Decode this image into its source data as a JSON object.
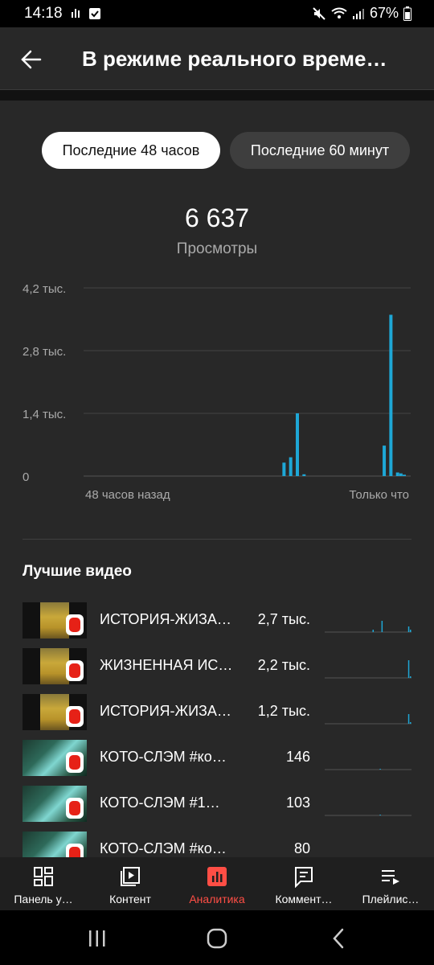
{
  "status": {
    "time": "14:18",
    "battery": "67%"
  },
  "header": {
    "title": "В режиме реального време…"
  },
  "chips": {
    "active_label": "Последние 48 часов",
    "inactive_label": "Последние 60 минут"
  },
  "metric": {
    "value": "6 637",
    "label": "Просмотры"
  },
  "chart_data": {
    "type": "bar",
    "ylabels": [
      "4,2 тыс.",
      "2,8 тыс.",
      "1,4 тыс.",
      "0"
    ],
    "yticks": [
      4200,
      2800,
      1400,
      0
    ],
    "ylim": [
      0,
      4200
    ],
    "x_start_label": "48 часов назад",
    "x_end_label": "Только что",
    "x_hours_ago": [
      18,
      17,
      16,
      15,
      3,
      2,
      1,
      0.5,
      0
    ],
    "values": [
      300,
      420,
      1400,
      40,
      680,
      3600,
      80,
      60,
      30
    ],
    "grid": true,
    "bar_color": "#1ea7d6"
  },
  "top_videos": {
    "title": "Лучшие видео",
    "items": [
      {
        "title": "ИСТОРИЯ-ЖИЗА…",
        "views": "2,7 тыс.",
        "thumb": "yellow",
        "spark": [
          0,
          0,
          0,
          0,
          0,
          0,
          0,
          0,
          0,
          0,
          0,
          0,
          0,
          0,
          0,
          0,
          0,
          0,
          0,
          0,
          0,
          0,
          0,
          0,
          0,
          0,
          3,
          0,
          0,
          0,
          0,
          14,
          0,
          0,
          0,
          0,
          0,
          0,
          0,
          0,
          0,
          0,
          0,
          0,
          0,
          0,
          7,
          3
        ]
      },
      {
        "title": "ЖИЗНЕННАЯ ИС…",
        "views": "2,2 тыс.",
        "thumb": "yellow",
        "spark": [
          0,
          0,
          0,
          0,
          0,
          0,
          0,
          0,
          0,
          0,
          0,
          0,
          0,
          0,
          0,
          0,
          0,
          0,
          0,
          0,
          0,
          0,
          0,
          0,
          0,
          0,
          0,
          0,
          0,
          0,
          0,
          0,
          0,
          0,
          0,
          0,
          0,
          0,
          0,
          0,
          0,
          0,
          0,
          0,
          0,
          0,
          22,
          2
        ]
      },
      {
        "title": "ИСТОРИЯ-ЖИЗА…",
        "views": "1,2 тыс.",
        "thumb": "yellow",
        "spark": [
          0,
          0,
          0,
          0,
          0,
          0,
          0,
          0,
          0,
          0,
          0,
          0,
          0,
          0,
          0,
          0,
          0,
          0,
          0,
          0,
          0,
          0,
          0,
          0,
          0,
          0,
          0,
          0,
          0,
          0,
          0,
          0,
          0,
          0,
          0,
          0,
          0,
          0,
          0,
          0,
          0,
          0,
          0,
          0,
          0,
          0,
          12,
          2
        ]
      },
      {
        "title": "КОТО-СЛЭМ #ко…",
        "views": "146",
        "thumb": "teal",
        "spark": [
          0,
          0,
          0,
          0,
          0,
          0,
          0,
          0,
          0,
          0,
          0,
          0,
          0,
          0,
          0,
          0,
          0,
          0,
          0,
          0,
          0,
          0,
          0,
          0,
          0,
          0,
          0,
          0,
          0,
          0,
          1,
          0,
          0,
          0,
          0,
          0,
          0,
          0,
          0,
          0,
          0,
          0,
          0,
          0,
          0,
          0,
          0,
          0
        ]
      },
      {
        "title": "КОТО-СЛЭМ #1…",
        "views": "103",
        "thumb": "teal",
        "spark": [
          0,
          0,
          0,
          0,
          0,
          0,
          0,
          0,
          0,
          0,
          0,
          0,
          0,
          0,
          0,
          0,
          0,
          0,
          0,
          0,
          0,
          0,
          0,
          0,
          0,
          0,
          0,
          0,
          0,
          0,
          1,
          0,
          0,
          0,
          0,
          0,
          0,
          0,
          0,
          0,
          0,
          0,
          0,
          0,
          0,
          0,
          0,
          0
        ]
      },
      {
        "title": "КОТО-СЛЭМ #ко…",
        "views": "80",
        "thumb": "teal",
        "spark": []
      }
    ]
  },
  "bottom_nav": {
    "items": [
      {
        "label": "Панель у…",
        "icon": "dashboard-icon"
      },
      {
        "label": "Контент",
        "icon": "content-icon"
      },
      {
        "label": "Аналитика",
        "icon": "analytics-icon",
        "active": true
      },
      {
        "label": "Коммент…",
        "icon": "comments-icon"
      },
      {
        "label": "Плейлис…",
        "icon": "playlist-icon"
      }
    ]
  },
  "colors": {
    "accent": "#ff4e45",
    "chart": "#1ea7d6",
    "surface": "#282828"
  }
}
